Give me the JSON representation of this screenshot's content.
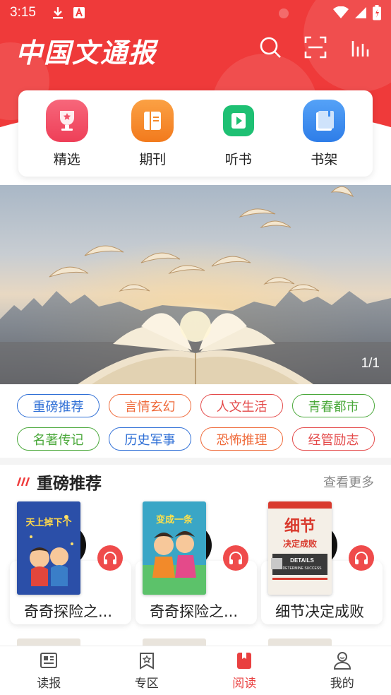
{
  "status_bar": {
    "time": "3:15"
  },
  "header": {
    "logo_text": "中国文通报",
    "actions": [
      "search-icon",
      "scan-icon",
      "chart-icon"
    ]
  },
  "quick_entries": [
    {
      "label": "精选",
      "icon": "trophy-icon",
      "color": "#f2536a"
    },
    {
      "label": "期刊",
      "icon": "journal-icon",
      "color": "#f58a2a"
    },
    {
      "label": "听书",
      "icon": "play-icon",
      "color": "#1ec073"
    },
    {
      "label": "书架",
      "icon": "bookshelf-icon",
      "color": "#3c8ef2"
    }
  ],
  "banner": {
    "counter": "1/1"
  },
  "tags": [
    {
      "label": "重磅推荐",
      "color": "#2f6fd6"
    },
    {
      "label": "言情玄幻",
      "color": "#ef6a3a"
    },
    {
      "label": "人文生活",
      "color": "#e44a4a"
    },
    {
      "label": "青春都市",
      "color": "#4aa83a"
    },
    {
      "label": "名著传记",
      "color": "#4aa83a"
    },
    {
      "label": "历史军事",
      "color": "#2f6fd6"
    },
    {
      "label": "恐怖推理",
      "color": "#ef6a3a"
    },
    {
      "label": "经管励志",
      "color": "#e44a4a"
    }
  ],
  "section": {
    "title": "重磅推荐",
    "more": "查看更多"
  },
  "books": [
    {
      "title": "奇奇探险之...",
      "cover_text": "天上掉下个",
      "cover_color": "#2b5fb0"
    },
    {
      "title": "奇奇探险之...",
      "cover_text": "变成一条",
      "cover_color": "#3a9ec0"
    },
    {
      "title": "细节决定成败",
      "cover_text": "细节决定成败",
      "cover_sub": "DETAILS DETERMINE SUCCESS AND FAILURE",
      "cover_color": "#e9e4dc"
    }
  ],
  "bottom_nav": [
    {
      "label": "读报",
      "icon": "newspaper-icon",
      "active": false
    },
    {
      "label": "专区",
      "icon": "zone-icon",
      "active": false
    },
    {
      "label": "阅读",
      "icon": "book-read-icon",
      "active": true
    },
    {
      "label": "我的",
      "icon": "user-icon",
      "active": false
    }
  ],
  "colors": {
    "brand_red": "#ef3a3a",
    "active_nav": "#e94040"
  }
}
